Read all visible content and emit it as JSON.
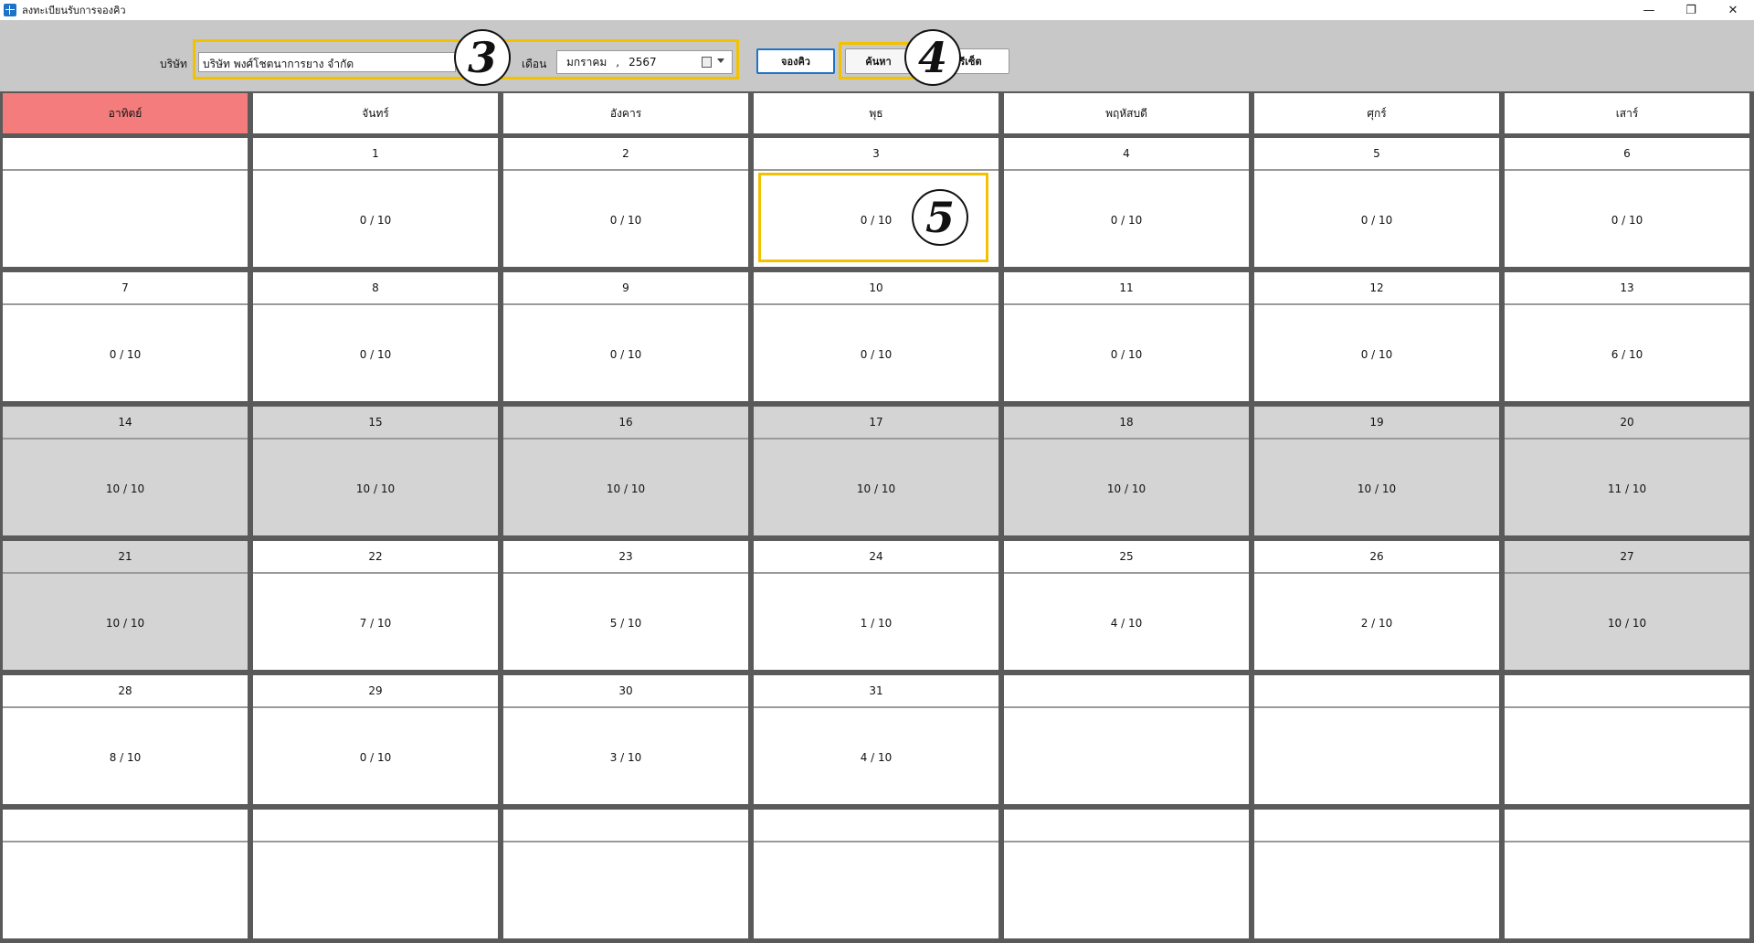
{
  "window": {
    "title": "ลงทะเบียนรับการจองคิว",
    "minimize": "—",
    "restore": "❐",
    "close": "✕"
  },
  "toolbar": {
    "company_label": "บริษัท",
    "company_value": "บริษัท พงศ์โชตนาการยาง จำกัด",
    "month_label": "เดือน",
    "month_value": "มกราคม",
    "month_sep": ",",
    "year_value": "2567",
    "book_button": "จองคิว",
    "search_button": "ค้นหา",
    "reset_button": "รีเซ็ต"
  },
  "annotations": [
    "3",
    "4",
    "5"
  ],
  "calendar": {
    "weekdays": [
      "อาทิตย์",
      "จันทร์",
      "อังคาร",
      "พุธ",
      "พฤหัสบดี",
      "ศุกร์",
      "เสาร์"
    ],
    "weeks": [
      [
        {
          "day": "",
          "count": "",
          "full": false
        },
        {
          "day": "1",
          "count": "0 / 10",
          "full": false
        },
        {
          "day": "2",
          "count": "0 / 10",
          "full": false
        },
        {
          "day": "3",
          "count": "0 / 10",
          "full": false
        },
        {
          "day": "4",
          "count": "0 / 10",
          "full": false
        },
        {
          "day": "5",
          "count": "0 / 10",
          "full": false
        },
        {
          "day": "6",
          "count": "0 / 10",
          "full": false
        }
      ],
      [
        {
          "day": "7",
          "count": "0 / 10",
          "full": false
        },
        {
          "day": "8",
          "count": "0 / 10",
          "full": false
        },
        {
          "day": "9",
          "count": "0 / 10",
          "full": false
        },
        {
          "day": "10",
          "count": "0 / 10",
          "full": false
        },
        {
          "day": "11",
          "count": "0 / 10",
          "full": false
        },
        {
          "day": "12",
          "count": "0 / 10",
          "full": false
        },
        {
          "day": "13",
          "count": "6 / 10",
          "full": false
        }
      ],
      [
        {
          "day": "14",
          "count": "10 / 10",
          "full": true
        },
        {
          "day": "15",
          "count": "10 / 10",
          "full": true
        },
        {
          "day": "16",
          "count": "10 / 10",
          "full": true
        },
        {
          "day": "17",
          "count": "10 / 10",
          "full": true
        },
        {
          "day": "18",
          "count": "10 / 10",
          "full": true
        },
        {
          "day": "19",
          "count": "10 / 10",
          "full": true
        },
        {
          "day": "20",
          "count": "11 / 10",
          "full": true
        }
      ],
      [
        {
          "day": "21",
          "count": "10 / 10",
          "full": true
        },
        {
          "day": "22",
          "count": "7 / 10",
          "full": false
        },
        {
          "day": "23",
          "count": "5 / 10",
          "full": false
        },
        {
          "day": "24",
          "count": "1 / 10",
          "full": false
        },
        {
          "day": "25",
          "count": "4 / 10",
          "full": false
        },
        {
          "day": "26",
          "count": "2 / 10",
          "full": false
        },
        {
          "day": "27",
          "count": "10 / 10",
          "full": true
        }
      ],
      [
        {
          "day": "28",
          "count": "8 / 10",
          "full": false
        },
        {
          "day": "29",
          "count": "0 / 10",
          "full": false
        },
        {
          "day": "30",
          "count": "3 / 10",
          "full": false
        },
        {
          "day": "31",
          "count": "4 / 10",
          "full": false
        },
        {
          "day": "",
          "count": "",
          "full": false
        },
        {
          "day": "",
          "count": "",
          "full": false
        },
        {
          "day": "",
          "count": "",
          "full": false
        }
      ],
      [
        {
          "day": "",
          "count": "",
          "full": false
        },
        {
          "day": "",
          "count": "",
          "full": false
        },
        {
          "day": "",
          "count": "",
          "full": false
        },
        {
          "day": "",
          "count": "",
          "full": false
        },
        {
          "day": "",
          "count": "",
          "full": false
        },
        {
          "day": "",
          "count": "",
          "full": false
        },
        {
          "day": "",
          "count": "",
          "full": false
        }
      ]
    ]
  }
}
